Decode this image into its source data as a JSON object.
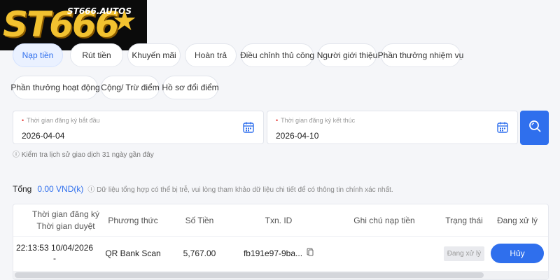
{
  "logo": {
    "big": "ST666",
    "small": "ST666.AUTOS",
    "star": "★"
  },
  "tabs": [
    {
      "label": "Nạp tiền",
      "active": true
    },
    {
      "label": "Rút tiền"
    },
    {
      "label": "Khuyến mãi"
    },
    {
      "label": "Hoàn trả"
    },
    {
      "label": "Điều chỉnh thủ công"
    },
    {
      "label": "Người giới thiệu"
    },
    {
      "label": "Phần thưởng nhiệm vụ"
    },
    {
      "label": "Phần thưởng hoạt động"
    },
    {
      "label": "Cộng/ Trừ điểm"
    },
    {
      "label": "Hồ sơ đổi điểm"
    }
  ],
  "filters": {
    "start": {
      "label": "Thời gian đăng ký bắt đầu",
      "value": "2026-04-04",
      "icon": "calendar-icon"
    },
    "end": {
      "label": "Thời gian đăng ký kết thúc",
      "value": "2026-04-10",
      "icon": "calendar-icon"
    },
    "search_icon": "search-icon",
    "required_mark": "•",
    "note": "ⓘ Kiểm tra lịch sử giao dịch 31 ngày gần đây"
  },
  "summary": {
    "label": "Tổng",
    "amount": "0.00 VND(k)",
    "hint": "ⓘ Dữ liệu tổng hợp có thể bị trễ, vui lòng tham khảo dữ liệu chi tiết để có thông tin chính xác nhất."
  },
  "table": {
    "headers": {
      "time_line1": "Thời gian đăng ký",
      "time_line2": "Thời gian duyệt",
      "method": "Phương thức",
      "amount": "Số Tiền",
      "txn": "Txn. ID",
      "note": "Ghi chú nạp tiền",
      "status": "Trạng thái",
      "processing": "Đang xử lý"
    },
    "rows": [
      {
        "time_line1": "22:13:53 10/04/2026",
        "time_line2": "-",
        "method": "QR Bank Scan",
        "amount": "5,767.00",
        "txn": "fb191e97-9ba...",
        "copy_icon": "copy-icon",
        "note": "",
        "status": "Đang xử lý",
        "action": "Hủy"
      }
    ]
  },
  "colors": {
    "accent": "#2f6fed",
    "logo_gold": "#f2c230",
    "logo_bg": "#0b0b0b"
  }
}
